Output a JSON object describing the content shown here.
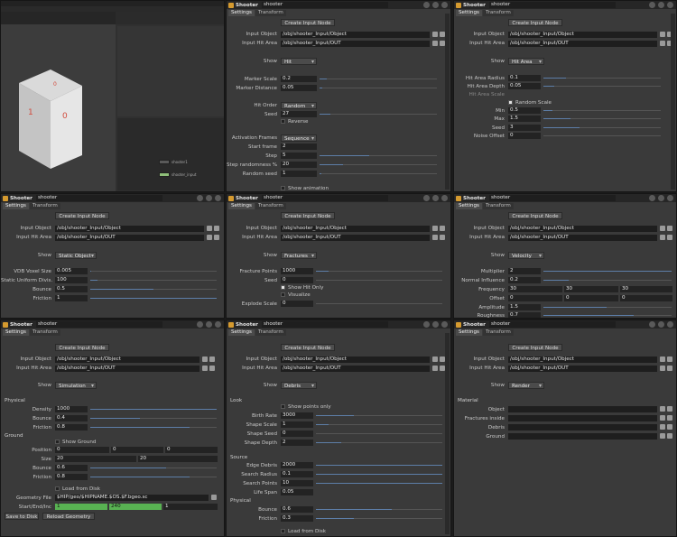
{
  "panel_title": "Shooter",
  "node_name": "shooter",
  "tabs": [
    "Settings",
    "Transform"
  ],
  "create_input": "Create Input Node",
  "input_object_label": "Input Object",
  "input_hit_label": "Input Hit Area",
  "input_object_value": "/obj/shooter_Input/Object",
  "input_hit_value": "/obj/shooter_Input/OUT",
  "show_label": "Show",
  "viewport": {
    "cube_labels": [
      "1",
      "0",
      "0"
    ],
    "net_nodes": [
      "shooter1",
      "shooter_input"
    ]
  },
  "p1": {
    "show": "Hit",
    "marker_scale_label": "Marker Scale",
    "marker_scale": "0.2",
    "marker_distance_label": "Marker Distance",
    "marker_distance": "0.05",
    "hit_order_label": "Hit Order",
    "hit_order": "Random",
    "seed_label": "Seed",
    "seed": "27",
    "reverse": "Reverse",
    "activation_label": "Activation Frames",
    "activation": "Sequence",
    "start_frame_label": "Start frame",
    "start_frame": "2",
    "step_label": "Step",
    "step": "5",
    "step_rand_label": "Step randomness %",
    "step_rand": "20",
    "random_seed_label": "Random seed",
    "random_seed": "1",
    "show_anim": "Show animation"
  },
  "p2": {
    "show": "Hit Area",
    "radius_label": "Hit Area Radius",
    "radius": "0.1",
    "depth_label": "Hit Area Depth",
    "depth": "0.05",
    "scale_label": "Hit Area Scale",
    "random_scale": "Random Scale",
    "min_label": "Min",
    "min": "0.5",
    "max_label": "Max",
    "max": "1.5",
    "seed_label": "Seed",
    "seed": "3",
    "noise_label": "Noise Offset",
    "noise": "0"
  },
  "p3": {
    "show": "Static Object",
    "vdb_label": "VDB Voxel Size",
    "vdb": "0.005",
    "sdf_label": "Static Uniform Divis.",
    "sdf": "100",
    "bounce_label": "Bounce",
    "bounce": "0.5",
    "friction_label": "Friction",
    "friction": "1"
  },
  "p4": {
    "show": "Fractures",
    "points_label": "Fracture Points",
    "points": "1000",
    "seed_label": "Seed",
    "seed": "0",
    "hit_only": "Show Hit Only",
    "visualize": "Visualize",
    "explode_label": "Explode Scale",
    "explode": "0"
  },
  "p5": {
    "show": "Velocity",
    "mult_label": "Multiplier",
    "mult": "2",
    "normal_label": "Normal Influence",
    "normal": "0.2",
    "freq_label": "Frequency",
    "freq": [
      "30",
      "30",
      "30"
    ],
    "offset_label": "Offset",
    "offset": [
      "0",
      "0",
      "0"
    ],
    "amp_label": "Amplitude",
    "amp": "1.5",
    "rough_label": "Roughness",
    "rough": "0.7"
  },
  "p6": {
    "show": "Simulation",
    "physical": "Physical",
    "density_label": "Density",
    "density": "1000",
    "bounce_label": "Bounce",
    "bounce": "0.4",
    "friction_label": "Friction",
    "friction": "0.8",
    "ground": "Ground",
    "show_ground": "Show Ground",
    "position_label": "Position",
    "position": [
      "0",
      "0",
      "0"
    ],
    "size_label": "Size",
    "size": [
      "20",
      "20"
    ],
    "gbounce_label": "Bounce",
    "gbounce": "0.6",
    "gfriction_label": "Friction",
    "gfriction": "0.8",
    "load_disk": "Load from Disk",
    "geo_label": "Geometry File",
    "geo": "$HIP/geo/$HIPNAME.$OS.$F.bgeo.sc",
    "startend_label": "Start/End/Inc",
    "startend": [
      "1",
      "240",
      "1"
    ],
    "save_btn": "Save to Disk",
    "reload_btn": "Reload Geometry"
  },
  "p7": {
    "show": "Debris",
    "look": "Look",
    "show_pts": "Show points only",
    "birth_label": "Birth Rate",
    "birth": "3000",
    "shape_scale_label": "Shape Scale",
    "shape_scale": "1",
    "shape_seed_label": "Shape Seed",
    "shape_seed": "0",
    "shape_depth_label": "Shape Depth",
    "shape_depth": "2",
    "source": "Source",
    "edge_label": "Edge Debris",
    "edge": "2000",
    "radius_label": "Search Radius",
    "radius": "0.1",
    "sp_label": "Search Points",
    "sp": "10",
    "life_label": "Life Span",
    "life": "0.05",
    "physical": "Physical",
    "bounce_label": "Bounce",
    "bounce": "0.6",
    "friction_label": "Friction",
    "friction": "0.3",
    "load_disk": "Load from Disk"
  },
  "p8": {
    "show": "Render",
    "material": "Material",
    "object_label": "Object",
    "frac_label": "Fractures inside",
    "debris_label": "Debris",
    "ground_label": "Ground"
  },
  "colors": {
    "accent": "#5d7ea8",
    "progress": "#58b252",
    "header": "#262626",
    "panel": "#3a3a3a"
  }
}
